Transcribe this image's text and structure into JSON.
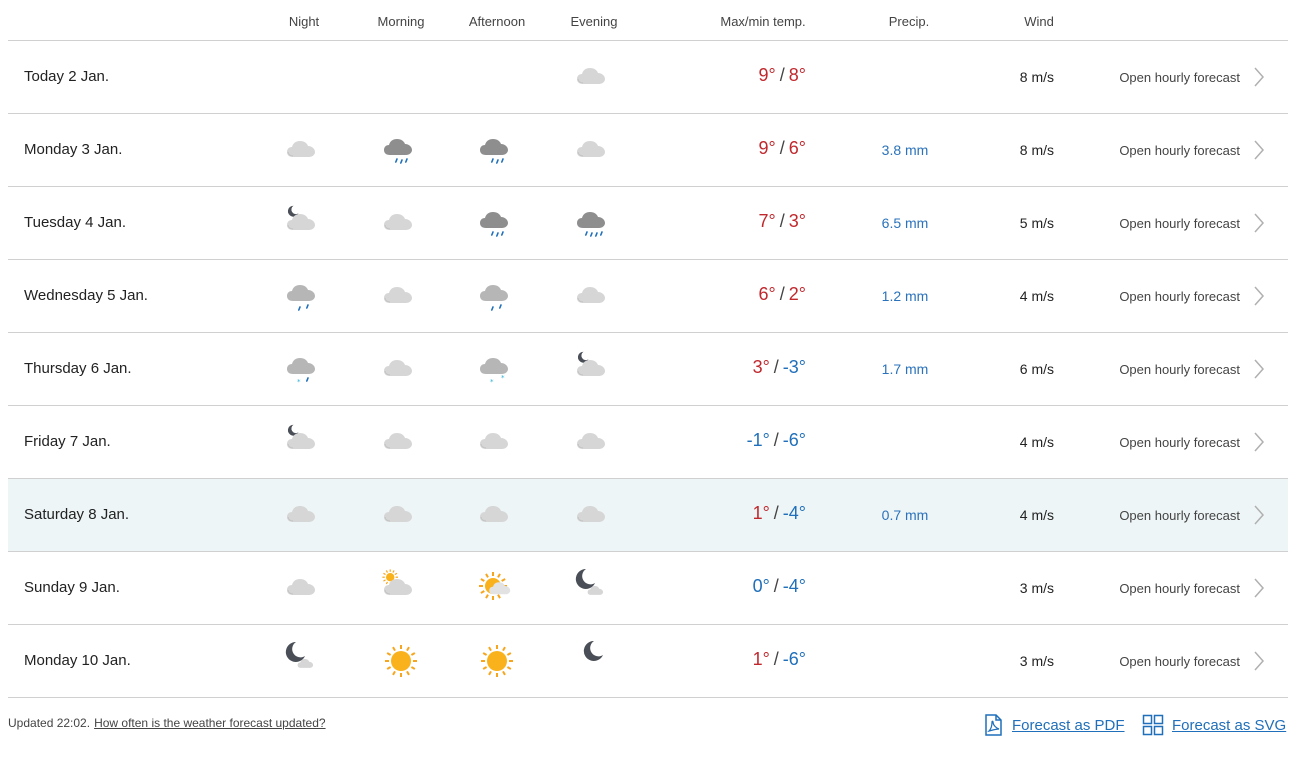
{
  "header": {
    "night": "Night",
    "morning": "Morning",
    "afternoon": "Afternoon",
    "evening": "Evening",
    "temp": "Max/min temp.",
    "precip": "Precip.",
    "wind": "Wind"
  },
  "colors": {
    "warm": "#c0282d",
    "cold": "#1f6fba",
    "precip": "#2a72bb",
    "highlight": "#eef5f6"
  },
  "rows": [
    {
      "day": "Today 2 Jan.",
      "icons": [
        "",
        "",
        "",
        "cloud"
      ],
      "max": "9°",
      "min": "8°",
      "maxCold": false,
      "minCold": false,
      "precip": "",
      "wind": "8 m/s",
      "link": "Open hourly forecast"
    },
    {
      "day": "Monday 3 Jan.",
      "icons": [
        "cloud",
        "rain-cloud",
        "rain-cloud",
        "cloud"
      ],
      "max": "9°",
      "min": "6°",
      "maxCold": false,
      "minCold": false,
      "precip": "3.8 mm",
      "wind": "8 m/s",
      "link": "Open hourly forecast"
    },
    {
      "day": "Tuesday 4 Jan.",
      "icons": [
        "moon-cloud",
        "cloud",
        "rain-cloud",
        "heavy-rain-cloud"
      ],
      "max": "7°",
      "min": "3°",
      "maxCold": false,
      "minCold": false,
      "precip": "6.5 mm",
      "wind": "5 m/s",
      "link": "Open hourly forecast"
    },
    {
      "day": "Wednesday 5 Jan.",
      "icons": [
        "light-rain-cloud",
        "cloud",
        "light-rain-cloud",
        "cloud"
      ],
      "max": "6°",
      "min": "2°",
      "maxCold": false,
      "minCold": false,
      "precip": "1.2 mm",
      "wind": "4 m/s",
      "link": "Open hourly forecast"
    },
    {
      "day": "Thursday 6 Jan.",
      "icons": [
        "sleet-cloud",
        "cloud",
        "snow-cloud",
        "moon-cloud"
      ],
      "max": "3°",
      "min": "-3°",
      "maxCold": false,
      "minCold": true,
      "precip": "1.7 mm",
      "wind": "6 m/s",
      "link": "Open hourly forecast"
    },
    {
      "day": "Friday 7 Jan.",
      "icons": [
        "moon-cloud",
        "cloud",
        "cloud",
        "cloud"
      ],
      "max": "-1°",
      "min": "-6°",
      "maxCold": true,
      "minCold": true,
      "precip": "",
      "wind": "4 m/s",
      "link": "Open hourly forecast"
    },
    {
      "day": "Saturday 8 Jan.",
      "icons": [
        "cloud",
        "cloud",
        "cloud",
        "cloud"
      ],
      "max": "1°",
      "min": "-4°",
      "maxCold": false,
      "minCold": true,
      "precip": "0.7 mm",
      "wind": "4 m/s",
      "link": "Open hourly forecast",
      "highlight": true
    },
    {
      "day": "Sunday 9 Jan.",
      "icons": [
        "cloud",
        "sun-cloud-small",
        "sun-cloud",
        "moon-small-cloud"
      ],
      "max": "0°",
      "min": "-4°",
      "maxCold": true,
      "minCold": true,
      "precip": "",
      "wind": "3 m/s",
      "link": "Open hourly forecast"
    },
    {
      "day": "Monday 10 Jan.",
      "icons": [
        "moon-small-cloud",
        "sun",
        "sun",
        "moon"
      ],
      "max": "1°",
      "min": "-6°",
      "maxCold": false,
      "minCold": true,
      "precip": "",
      "wind": "3 m/s",
      "link": "Open hourly forecast"
    }
  ],
  "footer": {
    "updated": "Updated 22:02.",
    "help_link": "How often is the weather forecast updated?",
    "pdf": "Forecast as PDF",
    "svg": "Forecast as SVG"
  }
}
